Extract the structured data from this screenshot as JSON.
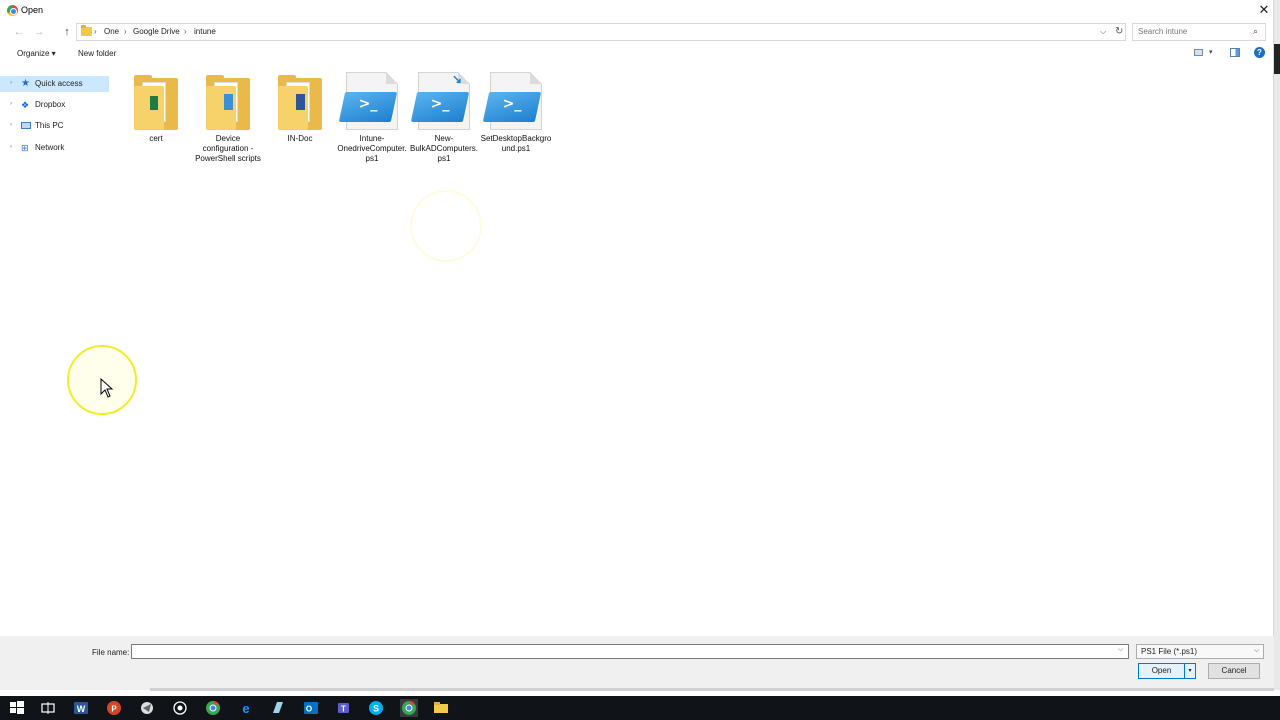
{
  "window": {
    "title": "Open",
    "close_glyph": "✕"
  },
  "nav": {
    "back_glyph": "←",
    "forward_glyph": "→",
    "up_glyph": "↑",
    "breadcrumbs": [
      "One",
      "Google Drive",
      "intune"
    ],
    "separator": "›",
    "dropdown_glyph": "⌵",
    "refresh_glyph": "↻"
  },
  "search": {
    "placeholder": "Search intune",
    "icon": "search-icon"
  },
  "toolbar": {
    "organize": "Organize ▾",
    "new_folder": "New folder",
    "help": "?"
  },
  "sidebar": {
    "items": [
      {
        "label": "Quick access",
        "icon": "star-icon",
        "selected": true
      },
      {
        "label": "Dropbox",
        "icon": "dropbox-icon",
        "selected": false
      },
      {
        "label": "This PC",
        "icon": "computer-icon",
        "selected": false
      },
      {
        "label": "Network",
        "icon": "network-icon",
        "selected": false
      }
    ]
  },
  "files": [
    {
      "label": "cert",
      "type": "folder",
      "badge": "excel"
    },
    {
      "label": "Device configuration - PowerShell scripts",
      "type": "folder",
      "badge": "powershell"
    },
    {
      "label": "IN-Doc",
      "type": "folder",
      "badge": "word"
    },
    {
      "label": "Intune-OnedriveComputer.ps1",
      "type": "ps1"
    },
    {
      "label": "New-BulkADComputers.ps1",
      "type": "ps1-shortcut"
    },
    {
      "label": "SetDesktopBackground.ps1",
      "type": "ps1"
    }
  ],
  "bottom": {
    "file_name_label": "File name:",
    "file_name_value": "",
    "file_type": "PS1 File (*.ps1)",
    "open": "Open",
    "cancel": "Cancel"
  },
  "taskbar": {
    "items": [
      "windows-start-icon",
      "task-view-icon",
      "word-icon",
      "powerpoint-icon",
      "app-icon",
      "cortana-icon",
      "chrome-icon",
      "edge-icon",
      "notes-icon",
      "outlook-icon",
      "teams-icon",
      "skype-icon",
      "chrome-active-icon",
      "file-explorer-icon"
    ]
  }
}
